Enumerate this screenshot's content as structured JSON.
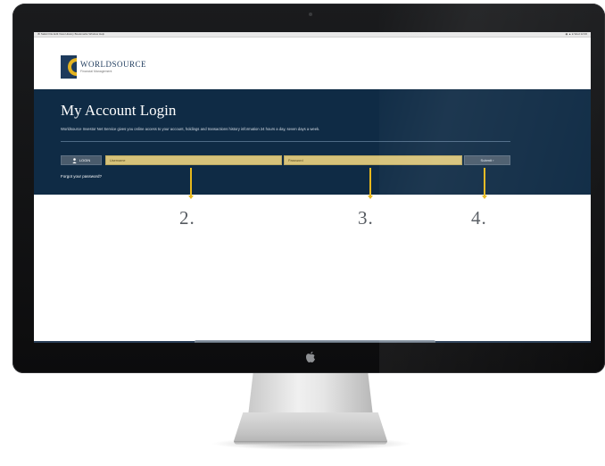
{
  "menubar": {
    "left_text": "⌘ Safari File Edit View History Bookmarks Window Help",
    "right_text": "◉ ▲ ● Wed 12:00"
  },
  "site": {
    "logo_name": "WORLDSOURCE",
    "logo_tagline": "Financial Management"
  },
  "login_panel": {
    "title": "My Account Login",
    "description": "Worldsource Investor Net Service gives you online access to your account, holdings and transactions history information 24 hours a day, seven days a week.",
    "login_button": "LOGIN",
    "username_placeholder": "Username",
    "password_placeholder": "Password",
    "submit_button": "Submit ›",
    "forgot_link": "Forgot your password?"
  },
  "annotations": {
    "label_2": "2.",
    "label_3": "3.",
    "label_4": "4."
  },
  "colors": {
    "panel_bg": "#0f2b45",
    "field_bg": "#d6c27a",
    "arrow": "#e8b81c",
    "button_bg": "#4a5b6c"
  },
  "icons": [
    "user-icon",
    "apple-logo-icon",
    "worldsource-logo-mark"
  ]
}
